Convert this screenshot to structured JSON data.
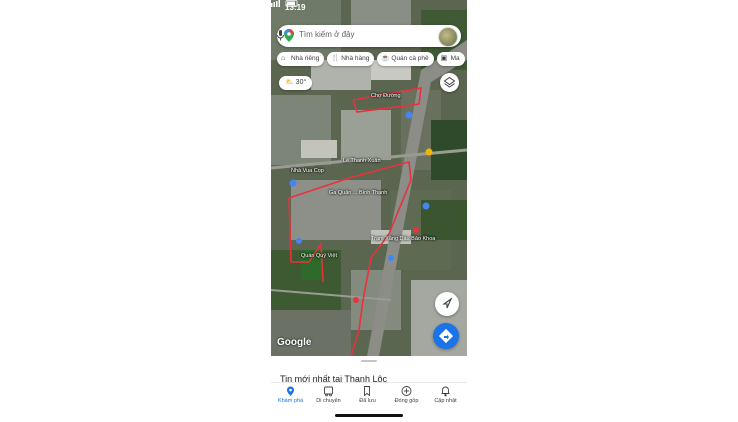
{
  "status_bar": {
    "time": "13:19"
  },
  "search": {
    "placeholder": "Tìm kiếm ở đây"
  },
  "chips": [
    {
      "icon": "home-icon",
      "label": "Nhà riêng"
    },
    {
      "icon": "restaurant-icon",
      "label": "Nhà hàng"
    },
    {
      "icon": "coffee-icon",
      "label": "Quán cà phê"
    },
    {
      "icon": "shopping-bag-icon",
      "label": "Ma"
    }
  ],
  "weather": {
    "temperature": "30°"
  },
  "map_labels": [
    "Chợ Đường",
    "Ga Quận ... Bình Thạnh",
    "Nhà Vua Cọp",
    "Lê Thanh Xuân",
    "Trạm Xăng Dầu Bảo Khoa",
    "Quán Quý Việt"
  ],
  "google_logo": "Google",
  "bottom_sheet": {
    "title": "Tin mới nhất tại Thanh Lộc"
  },
  "nav": [
    {
      "id": "explore",
      "icon": "location-pin-icon",
      "label": "Khám phá",
      "active": true
    },
    {
      "id": "commute",
      "icon": "commute-icon",
      "label": "Di chuyển",
      "active": false
    },
    {
      "id": "saved",
      "icon": "bookmark-icon",
      "label": "Đã lưu",
      "active": false
    },
    {
      "id": "contribute",
      "icon": "plus-circle-icon",
      "label": "Đóng góp",
      "active": false
    },
    {
      "id": "updates",
      "icon": "bell-icon",
      "label": "Cập nhật",
      "active": false
    }
  ],
  "colors": {
    "accent": "#1a73e8",
    "boundary": "#e8323c"
  }
}
